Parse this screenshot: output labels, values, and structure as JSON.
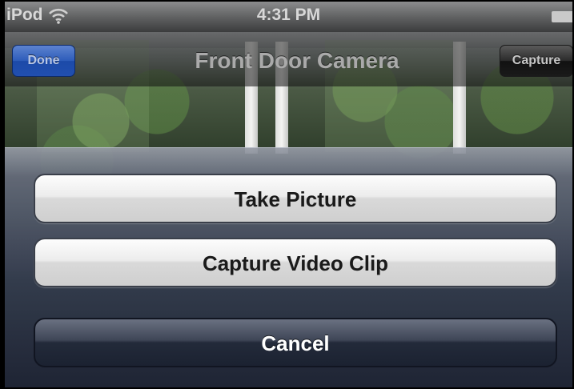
{
  "status_bar": {
    "carrier": "iPod",
    "time": "4:31 PM",
    "wifi_icon": "wifi-icon",
    "battery_icon": "battery-icon"
  },
  "nav_bar": {
    "title": "Front Door Camera",
    "left_button": "Done",
    "right_button": "Capture"
  },
  "action_sheet": {
    "buttons": [
      {
        "label": "Take Picture",
        "style": "default"
      },
      {
        "label": "Capture Video Clip",
        "style": "default"
      },
      {
        "label": "Cancel",
        "style": "cancel"
      }
    ]
  },
  "colors": {
    "done_button": "#2d5cba",
    "sheet_background": "#343c4e",
    "cancel_button": "#232a3a"
  }
}
